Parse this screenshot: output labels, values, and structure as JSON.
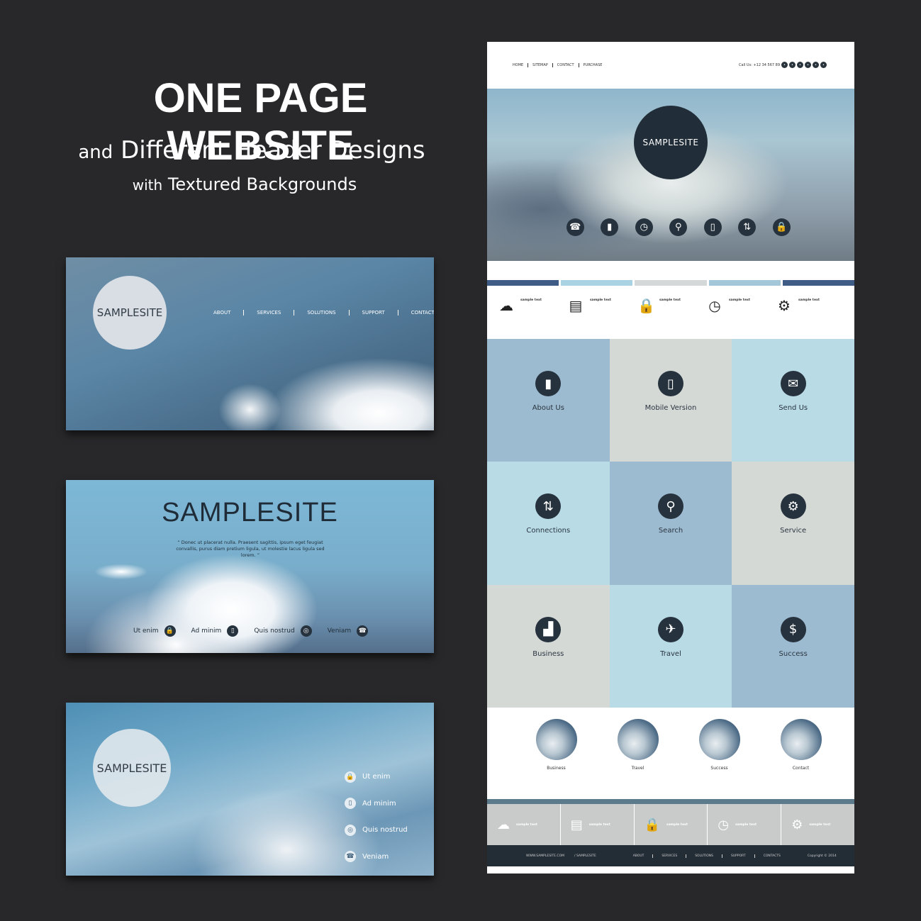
{
  "promo": {
    "title": "ONE PAGE WEBSITE",
    "line1_small": "and",
    "line1": "Different Header Designs",
    "line2_small": "with",
    "line2": "Textured Backgrounds"
  },
  "banner1": {
    "logo": "SAMPLESITE",
    "nav": [
      "ABOUT",
      "SERVICES",
      "SOLUTIONS",
      "SUPPORT",
      "CONTACTS"
    ]
  },
  "banner2": {
    "title": "SAMPLESITE",
    "quote": "“ Donec ut placerat nulla. Praesent sagittis, ipsum eget feugiat convallis, purus diam pretium ligula, ut molestie lacus ligula sed lorem. ”",
    "items": [
      {
        "label": "Ut enim",
        "icon": "lock-icon",
        "glyph": "🔒"
      },
      {
        "label": "Ad minim",
        "icon": "mobile-icon",
        "glyph": "▯"
      },
      {
        "label": "Quis nostrud",
        "icon": "target-icon",
        "glyph": "◎"
      },
      {
        "label": "Veniam",
        "icon": "phone-icon",
        "glyph": "☎"
      }
    ]
  },
  "banner3": {
    "logo": "SAMPLESITE",
    "items": [
      {
        "label": "Ut enim",
        "icon": "lock-icon",
        "glyph": "🔒"
      },
      {
        "label": "Ad minim",
        "icon": "mobile-icon",
        "glyph": "▯"
      },
      {
        "label": "Quis nostrud",
        "icon": "target-icon",
        "glyph": "◎"
      },
      {
        "label": "Veniam",
        "icon": "phone-icon",
        "glyph": "☎"
      }
    ]
  },
  "site": {
    "nav": [
      "HOME",
      "SITEMAP",
      "CONTACT",
      "PURCHASE"
    ],
    "call": "Call Us: +12 34 567 89",
    "social": [
      "home-icon",
      "settings-icon",
      "web-icon",
      "share-icon",
      "chat-icon",
      "mail-icon"
    ],
    "logo": "SAMPLESITE",
    "hero_icons": [
      {
        "icon": "phone-icon",
        "glyph": "☎"
      },
      {
        "icon": "book-icon",
        "glyph": "▮"
      },
      {
        "icon": "clock-icon",
        "glyph": "◷"
      },
      {
        "icon": "search-icon",
        "glyph": "⚲"
      },
      {
        "icon": "mobile-icon",
        "glyph": "▯"
      },
      {
        "icon": "connections-icon",
        "glyph": "⇅"
      },
      {
        "icon": "lock-icon",
        "glyph": "🔒"
      }
    ],
    "bar_colors": [
      "#3e5c86",
      "#a9d2e2",
      "#d5d8d8",
      "#a3c7d8",
      "#3e5c86"
    ],
    "features": [
      {
        "icon": "cloud-icon",
        "glyph": "☁",
        "title": "sample text"
      },
      {
        "icon": "document-icon",
        "glyph": "▤",
        "title": "sample text"
      },
      {
        "icon": "lock-icon",
        "glyph": "🔒",
        "title": "sample text"
      },
      {
        "icon": "clock-icon",
        "glyph": "◷",
        "title": "sample text"
      },
      {
        "icon": "gear-icon",
        "glyph": "⚙",
        "title": "sample text"
      }
    ],
    "tiles": [
      {
        "title": "About Us",
        "icon": "book-icon",
        "glyph": "▮",
        "color": "#9dbbd0"
      },
      {
        "title": "Mobile Version",
        "icon": "mobile-icon",
        "glyph": "▯",
        "color": "#d5d9d6"
      },
      {
        "title": "Send Us",
        "icon": "mail-icon",
        "glyph": "✉",
        "color": "#b8dbe6"
      },
      {
        "title": "Connections",
        "icon": "connections-icon",
        "glyph": "⇅",
        "color": "#b8dbe6"
      },
      {
        "title": "Search",
        "icon": "search-icon",
        "glyph": "⚲",
        "color": "#9dbbd0"
      },
      {
        "title": "Service",
        "icon": "gear-icon",
        "glyph": "⚙",
        "color": "#d5d9d6"
      },
      {
        "title": "Business",
        "icon": "chart-icon",
        "glyph": "▟",
        "color": "#d5d9d6"
      },
      {
        "title": "Travel",
        "icon": "plane-icon",
        "glyph": "✈",
        "color": "#b8dbe6"
      },
      {
        "title": "Success",
        "icon": "dollar-icon",
        "glyph": "$",
        "color": "#9dbbd0"
      }
    ],
    "circles": [
      "Business",
      "Travel",
      "Success",
      "Contact"
    ],
    "gray_features": [
      {
        "icon": "cloud-icon",
        "glyph": "☁",
        "title": "sample text"
      },
      {
        "icon": "document-icon",
        "glyph": "▤",
        "title": "sample text"
      },
      {
        "icon": "lock-icon",
        "glyph": "🔒",
        "title": "sample text"
      },
      {
        "icon": "clock-icon",
        "glyph": "◷",
        "title": "sample text"
      },
      {
        "icon": "gear-icon",
        "glyph": "⚙",
        "title": "sample text"
      }
    ],
    "footer": {
      "url": "WWW.SAMPLESITE.COM",
      "handle": "/ SAMPLESITE",
      "nav": [
        "ABOUT",
        "SERVICES",
        "SOLUTIONS",
        "SUPPORT",
        "CONTACTS"
      ],
      "copyright": "Copyright © 2014"
    }
  }
}
